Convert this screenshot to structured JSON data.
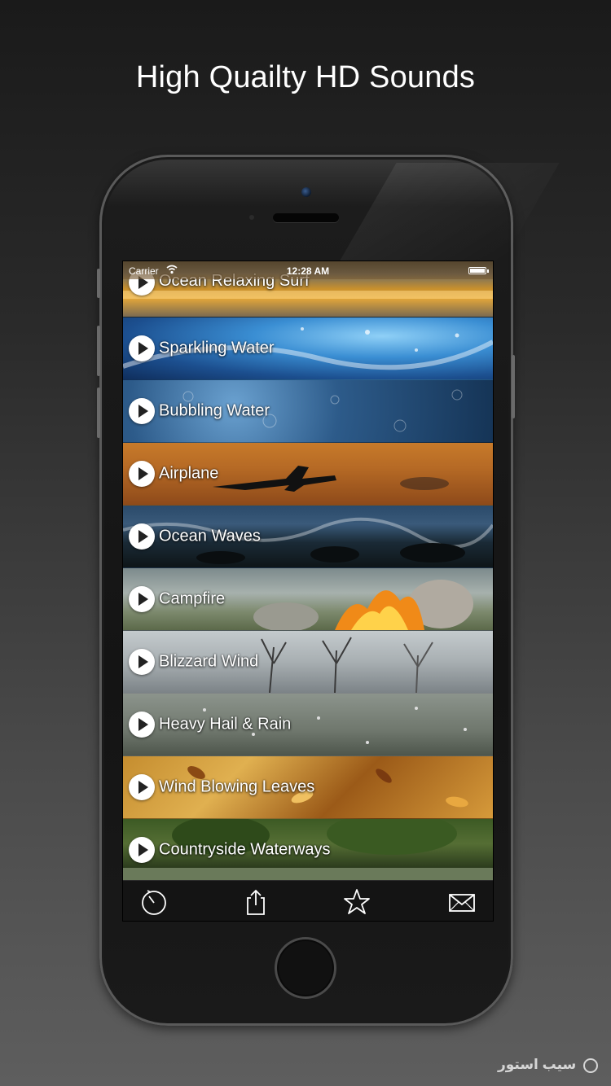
{
  "headline": "High Quailty HD Sounds",
  "status_bar": {
    "carrier": "Carrier",
    "time": "12:28 AM"
  },
  "sounds": [
    {
      "label": "Ocean Relaxing Surf",
      "bg": "bg-surf"
    },
    {
      "label": "Sparkling Water",
      "bg": "bg-sparkle"
    },
    {
      "label": "Bubbling Water",
      "bg": "bg-bubble"
    },
    {
      "label": "Airplane",
      "bg": "bg-airplane"
    },
    {
      "label": "Ocean Waves",
      "bg": "bg-ocean"
    },
    {
      "label": "Campfire",
      "bg": "bg-campfire"
    },
    {
      "label": "Blizzard Wind",
      "bg": "bg-blizzard"
    },
    {
      "label": "Heavy Hail & Rain",
      "bg": "bg-hail"
    },
    {
      "label": "Wind Blowing Leaves",
      "bg": "bg-leaves"
    },
    {
      "label": "Countryside Waterways",
      "bg": "bg-country"
    }
  ],
  "tabbar": {
    "icons": [
      "timer-icon",
      "share-icon",
      "star-icon",
      "mail-icon"
    ]
  },
  "watermark": "سیب استور"
}
